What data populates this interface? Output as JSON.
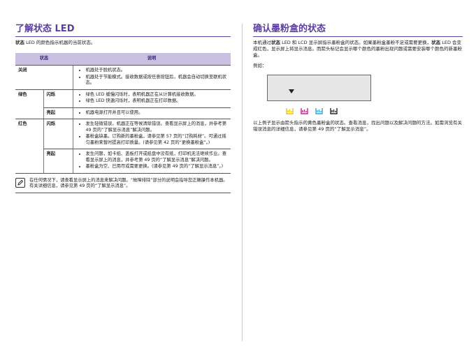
{
  "left": {
    "title": "了解状态 LED",
    "intro_bold": "状态",
    "intro_rest": " LED 的颜色指示机器的当前状态。",
    "table": {
      "header_status": "状态",
      "header_desc": "说明",
      "rows": {
        "off": {
          "color": "关闭",
          "items": [
            "机器处于脱机状态。",
            "机器处于节能模式。接收数据或按任意按钮后，机器会自动切换至联机状态。"
          ]
        },
        "green_blink": {
          "color": "绿色",
          "mode": "闪烁",
          "items": [
            "绿色 LED 缓慢闪烁时，表明机器正在从计算机接收数据。",
            "绿色 LED 快速闪烁时，表明机器正在打印数据。"
          ]
        },
        "green_on": {
          "mode": "亮起",
          "items": [
            "机器电源打开并且可以使用。"
          ]
        },
        "red_blink": {
          "color": "红色",
          "mode": "闪烁",
          "items": [
            "发生轻微错误，机器正在等候清除错误。查看显示屏上的消息，并参考第 49 页的“了解显示消息”解决问题。",
            "墨粉盒缺墨。订购新的墨粉盒，请参见第 57 页的“订购耗材”。可通过摇匀墨粉来暂时提高打印质量。(请参见第 42 页的“更换墨粉盒”。)"
          ]
        },
        "red_on": {
          "mode": "亮起",
          "items": [
            "发生问题，如卡纸、盖板打开或纸盘中没有纸，打印机无法继续作业。查看显示屏上的消息，并参考第 49 页的“了解显示消息”解决问题。",
            "墨粉盒为空、已用尽或需要更换。(请参见第 49 页的“了解显示消息”。)"
          ]
        }
      }
    },
    "note": "在任何情况下，请查看显示屏上的消息来解决问题。“故障排除”部分的说明会指导您正确操作本机器。有关详细信息，请参见第 49 页的“了解显示消息”。"
  },
  "right": {
    "title": "确认墨粉盒的状态",
    "p1_a": "本机通过",
    "p1_b1": "状态",
    "p1_c": " LED 和 LCD 显示屏指示墨粉盒的状态。如果墨粉盒墨粉不足或需要更换，",
    "p1_b2": "状态",
    "p1_d": " LED 会变成红色，显示屏上将显示消息。而箭头标记会显示哪个颜色的墨粉出现问题或需要安装哪个颜色的新墨粉盒。",
    "example_label": "例如：",
    "toner_colors": [
      "#f2c200",
      "#d4159a",
      "#2ba6d8",
      "#222222"
    ],
    "p2": "以上例子显示由箭头指示的黄色墨粉盒的状态。查看消息，找出问题以及解决问题的方法。如需浏览有关错误消息的详细信息，请参见第 49 页的“了解显示消息”。"
  }
}
